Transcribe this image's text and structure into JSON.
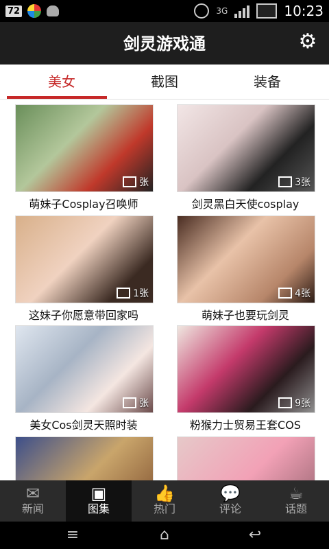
{
  "status": {
    "notif_count": "72",
    "network": "3G",
    "time": "10:23"
  },
  "app": {
    "title": "剑灵游戏通"
  },
  "tabs": [
    {
      "label": "美女"
    },
    {
      "label": "截图"
    },
    {
      "label": "装备"
    }
  ],
  "grid": [
    {
      "caption": "萌妹子Cosplay召唤师",
      "count": "张"
    },
    {
      "caption": "剑灵黑白天使cosplay",
      "count": "3张"
    },
    {
      "caption": "这妹子你愿意带回家吗",
      "count": "1张"
    },
    {
      "caption": "萌妹子也要玩剑灵",
      "count": "4张"
    },
    {
      "caption": "美女Cos剑灵天照时装",
      "count": "张"
    },
    {
      "caption": "粉猴力士贸易王套COS",
      "count": "9张"
    }
  ],
  "bottom_nav": [
    {
      "label": "新闻",
      "icon": "mail-icon"
    },
    {
      "label": "图集",
      "icon": "gallery-icon"
    },
    {
      "label": "热门",
      "icon": "thumbs-up-icon"
    },
    {
      "label": "评论",
      "icon": "comment-icon"
    },
    {
      "label": "话题",
      "icon": "coffee-icon"
    }
  ],
  "colors": {
    "accent": "#c62828",
    "titlebar": "#1e1e1e",
    "bottom_nav": "#2b2b2b"
  }
}
